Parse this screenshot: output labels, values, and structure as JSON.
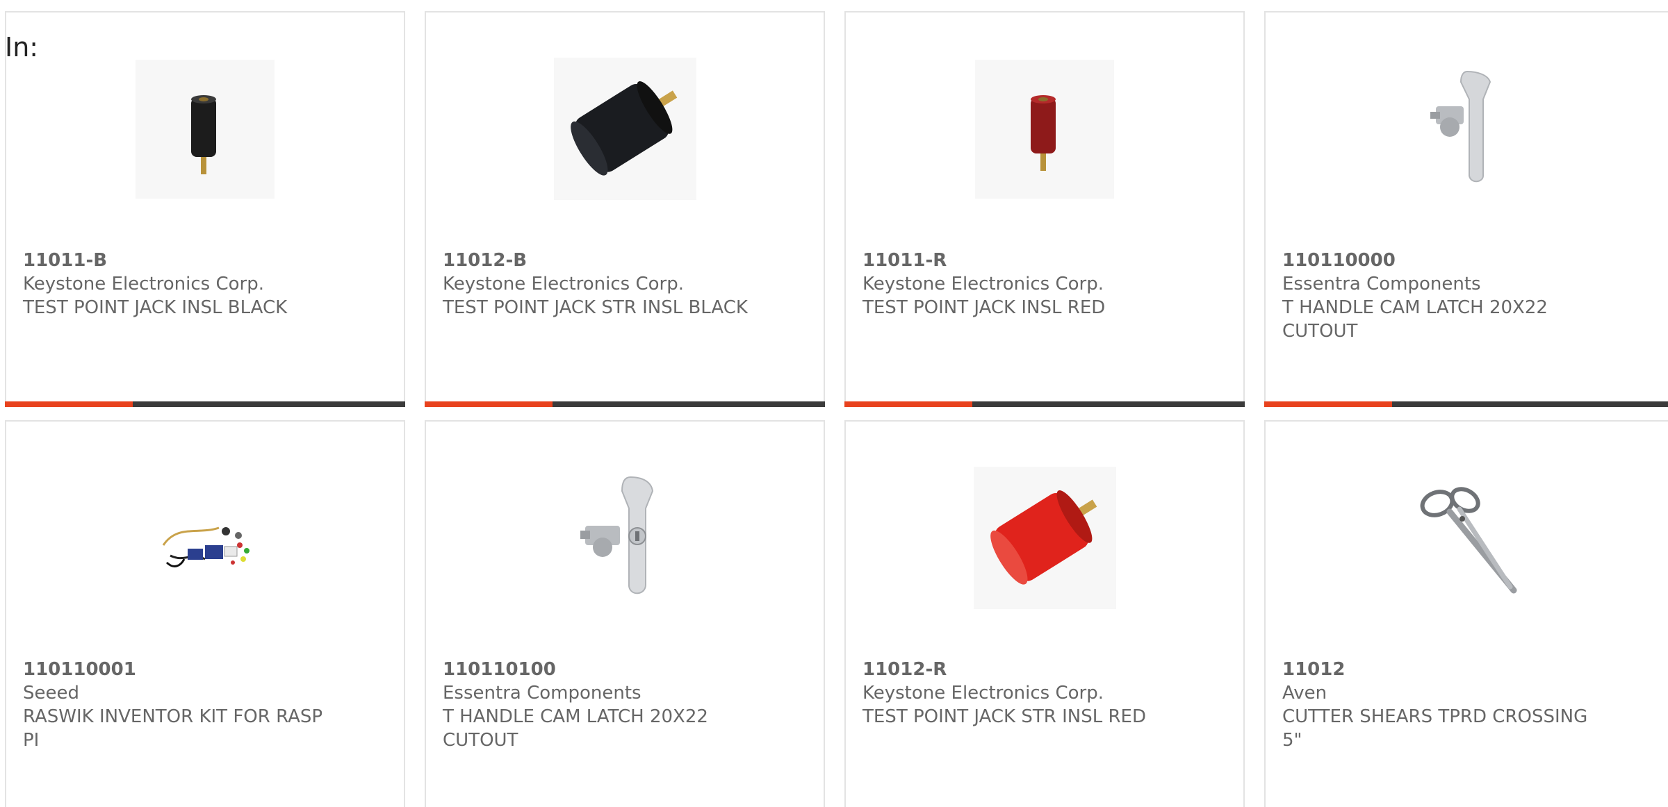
{
  "heading": "In:",
  "accent_color": "#e8421e",
  "bar_color": "#3b3b3b",
  "products": [
    {
      "part_number": "11011-B",
      "manufacturer": "Keystone Electronics Corp.",
      "description": "TEST POINT JACK INSL BLACK",
      "image": "black-test-point-jack-icon"
    },
    {
      "part_number": "11012-B",
      "manufacturer": "Keystone Electronics Corp.",
      "description": "TEST POINT JACK STR INSL BLACK",
      "image": "black-straight-test-point-jack-icon"
    },
    {
      "part_number": "11011-R",
      "manufacturer": "Keystone Electronics Corp.",
      "description": "TEST POINT JACK INSL RED",
      "image": "red-test-point-jack-icon"
    },
    {
      "part_number": "110110000",
      "manufacturer": "Essentra Components",
      "description": "T HANDLE CAM LATCH 20X22 CUTOUT",
      "image": "t-handle-latch-icon"
    },
    {
      "part_number": "110110001",
      "manufacturer": "Seeed",
      "description": "RASWIK INVENTOR KIT FOR RASP PI",
      "image": "inventor-kit-icon"
    },
    {
      "part_number": "110110100",
      "manufacturer": "Essentra Components",
      "description": "T HANDLE CAM LATCH 20X22 CUTOUT",
      "image": "t-handle-latch-keyed-icon"
    },
    {
      "part_number": "11012-R",
      "manufacturer": "Keystone Electronics Corp.",
      "description": "TEST POINT JACK STR INSL RED",
      "image": "red-straight-test-point-jack-icon"
    },
    {
      "part_number": "11012",
      "manufacturer": "Aven",
      "description": "CUTTER SHEARS TPRD CROSSING 5\"",
      "image": "shears-icon"
    }
  ]
}
